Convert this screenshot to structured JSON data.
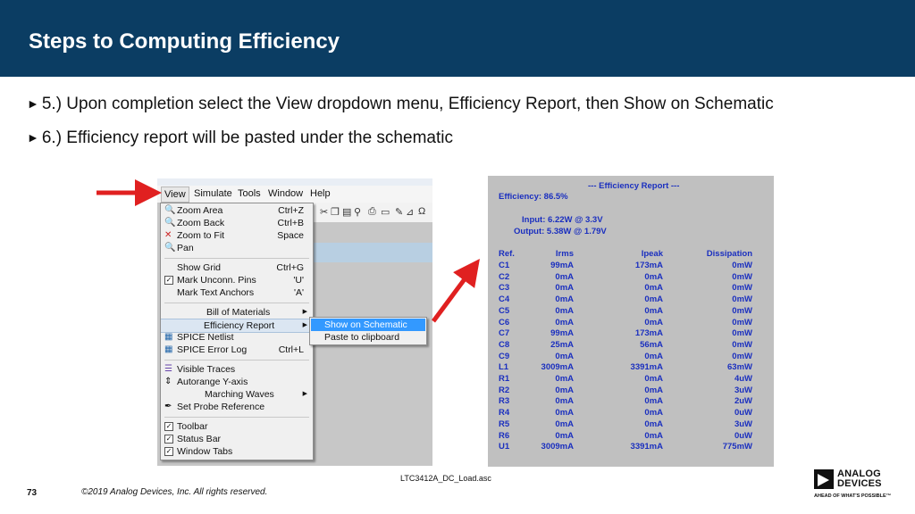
{
  "slide": {
    "title": "Steps to Computing Efficiency",
    "bullets": [
      "5.) Upon completion select the View dropdown menu, Efficiency Report, then Show on Schematic",
      "6.) Efficiency report will be pasted under the schematic"
    ],
    "bullet_marker": "►",
    "caption": "LTC3412A_DC_Load.asc",
    "page_number": "73",
    "copyright": "©2019 Analog Devices, Inc. All rights reserved.",
    "logo": {
      "line1": "ANALOG",
      "line2": "DEVICES",
      "tagline": "AHEAD OF WHAT'S POSSIBLE™"
    },
    "colors": {
      "header_bg": "#0b3d63",
      "arrow": "#e02020",
      "report_text": "#1a2fbf",
      "highlight": "#3399ff"
    }
  },
  "app": {
    "menubar": [
      "View",
      "Simulate",
      "Tools",
      "Window",
      "Help"
    ],
    "view_menu": [
      {
        "label": "Zoom Area",
        "shortcut": "Ctrl+Z",
        "icon": "zoom-area-icon"
      },
      {
        "label": "Zoom Back",
        "shortcut": "Ctrl+B",
        "icon": "zoom-back-icon"
      },
      {
        "label": "Zoom to Fit",
        "shortcut": "Space",
        "icon": "zoom-fit-icon"
      },
      {
        "label": "Pan",
        "shortcut": "",
        "icon": "pan-icon"
      },
      {
        "label": "Show Grid",
        "shortcut": "Ctrl+G",
        "icon": ""
      },
      {
        "label": "Mark Unconn. Pins",
        "shortcut": "'U'",
        "icon": "checkbox-checked"
      },
      {
        "label": "Mark Text Anchors",
        "shortcut": "'A'",
        "icon": ""
      },
      {
        "label": "Bill of Materials",
        "shortcut": "",
        "icon": "",
        "submenu": true
      },
      {
        "label": "Efficiency Report",
        "shortcut": "",
        "icon": "",
        "submenu": true,
        "highlighted": true
      },
      {
        "label": "SPICE Netlist",
        "shortcut": "",
        "icon": "netlist-icon"
      },
      {
        "label": "SPICE Error Log",
        "shortcut": "Ctrl+L",
        "icon": "error-log-icon"
      },
      {
        "label": "Visible Traces",
        "shortcut": "",
        "icon": "traces-icon"
      },
      {
        "label": "Autorange Y-axis",
        "shortcut": "",
        "icon": "autorange-icon"
      },
      {
        "label": "Marching Waves",
        "shortcut": "",
        "icon": "",
        "submenu": true
      },
      {
        "label": "Set Probe Reference",
        "shortcut": "",
        "icon": "probe-icon"
      },
      {
        "label": "Toolbar",
        "shortcut": "",
        "icon": "checkbox-checked"
      },
      {
        "label": "Status Bar",
        "shortcut": "",
        "icon": "checkbox-checked"
      },
      {
        "label": "Window Tabs",
        "shortcut": "",
        "icon": "checkbox-checked"
      }
    ],
    "submenu": [
      "Show on Schematic",
      "Paste to clipboard"
    ]
  },
  "report": {
    "header": "--- Efficiency Report ---",
    "efficiency": "Efficiency: 86.5%",
    "input": "Input: 6.22W @ 3.3V",
    "output": "Output: 5.38W @ 1.79V",
    "columns": [
      "Ref.",
      "Irms",
      "Ipeak",
      "Dissipation"
    ],
    "rows": [
      [
        "C1",
        "99mA",
        "173mA",
        "0mW"
      ],
      [
        "C2",
        "0mA",
        "0mA",
        "0mW"
      ],
      [
        "C3",
        "0mA",
        "0mA",
        "0mW"
      ],
      [
        "C4",
        "0mA",
        "0mA",
        "0mW"
      ],
      [
        "C5",
        "0mA",
        "0mA",
        "0mW"
      ],
      [
        "C6",
        "0mA",
        "0mA",
        "0mW"
      ],
      [
        "C7",
        "99mA",
        "173mA",
        "0mW"
      ],
      [
        "C8",
        "25mA",
        "56mA",
        "0mW"
      ],
      [
        "C9",
        "0mA",
        "0mA",
        "0mW"
      ],
      [
        "L1",
        "3009mA",
        "3391mA",
        "63mW"
      ],
      [
        "R1",
        "0mA",
        "0mA",
        "4uW"
      ],
      [
        "R2",
        "0mA",
        "0mA",
        "3uW"
      ],
      [
        "R3",
        "0mA",
        "0mA",
        "2uW"
      ],
      [
        "R4",
        "0mA",
        "0mA",
        "0uW"
      ],
      [
        "R5",
        "0mA",
        "0mA",
        "3uW"
      ],
      [
        "R6",
        "0mA",
        "0mA",
        "0uW"
      ],
      [
        "U1",
        "3009mA",
        "3391mA",
        "775mW"
      ]
    ]
  }
}
